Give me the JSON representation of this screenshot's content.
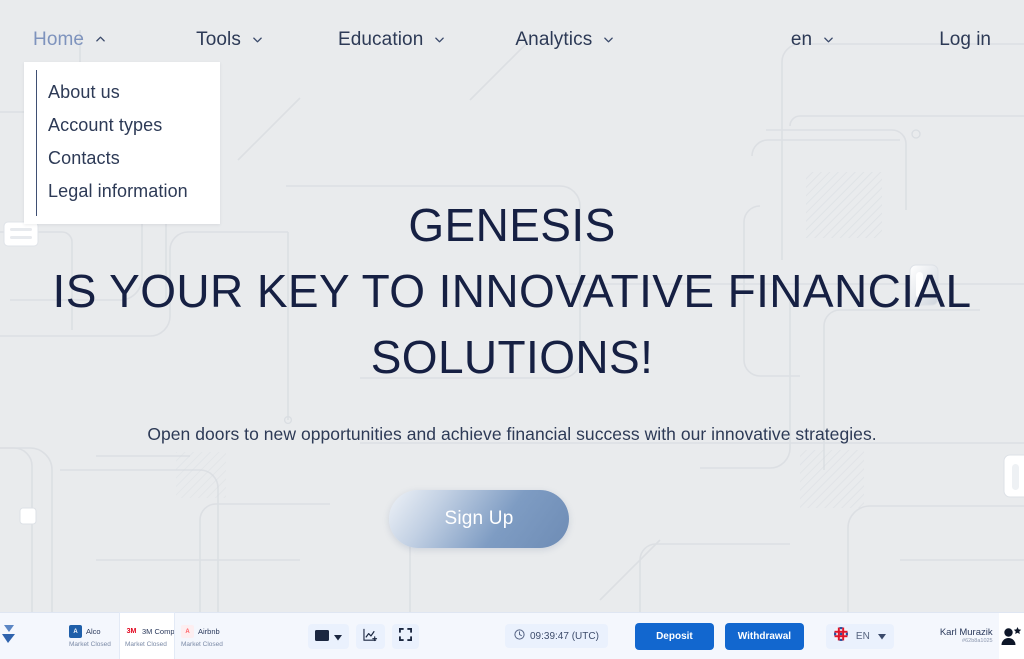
{
  "navbar": {
    "items": [
      {
        "label": "Home",
        "icon": "chevron-up-icon",
        "active": true
      },
      {
        "label": "Tools",
        "icon": "chevron-down-icon",
        "active": false
      },
      {
        "label": "Education",
        "icon": "chevron-down-icon",
        "active": false
      },
      {
        "label": "Analytics",
        "icon": "chevron-down-icon",
        "active": false
      }
    ],
    "language": {
      "label": "en",
      "icon": "chevron-down-icon"
    },
    "login_label": "Log in"
  },
  "dropdown": {
    "open_for": "Home",
    "items": [
      {
        "label": "About us"
      },
      {
        "label": "Account types"
      },
      {
        "label": "Contacts"
      },
      {
        "label": "Legal information"
      }
    ]
  },
  "hero": {
    "title_line1": "GENESIS",
    "title_line2": "IS YOUR KEY TO INNOVATIVE FINANCIAL",
    "title_line3": "SOLUTIONS!",
    "subtitle": "Open doors to new opportunities and achieve financial success with our innovative strategies.",
    "cta_label": "Sign Up"
  },
  "terminal": {
    "logo_icon": "brand-logo-icon",
    "tickers": [
      {
        "symbol_icon": "alcoa-logo-icon",
        "name": "Alco",
        "status": "Market Closed",
        "selected": false,
        "logo_bg": "#1f5fa9",
        "logo_text": "A"
      },
      {
        "symbol_icon": "3m-logo-icon",
        "name": "3M Comp",
        "status": "Market Closed",
        "selected": true,
        "logo_bg": "#ffffff",
        "logo_text": "3M"
      },
      {
        "symbol_icon": "airbnb-logo-icon",
        "name": "Airbnb",
        "status": "Market Closed",
        "selected": false,
        "logo_bg": "#fdeef0",
        "logo_text": "A"
      }
    ],
    "tools": [
      {
        "icon": "chart-type-icon",
        "has_caret": true
      },
      {
        "icon": "add-indicator-icon",
        "has_caret": false
      },
      {
        "icon": "fullscreen-icon",
        "has_caret": false
      }
    ],
    "clock": {
      "icon": "clock-icon",
      "text": "09:39:47 (UTC)"
    },
    "deposit_label": "Deposit",
    "withdrawal_label": "Withdrawal",
    "language": {
      "icon": "uk-flag-icon",
      "code": "EN",
      "caret": "caret-down-icon"
    },
    "user": {
      "name": "Karl Murazik",
      "id": "#62b8a1025",
      "avatar_icon": "user-star-icon"
    }
  },
  "colors": {
    "page_bg": "#e9ebed",
    "text_dark": "#162043",
    "text_nav": "#2d3a56",
    "nav_active": "#7e93bd",
    "accent_blue": "#1267cf",
    "terminal_bg": "#f4f7fd"
  }
}
